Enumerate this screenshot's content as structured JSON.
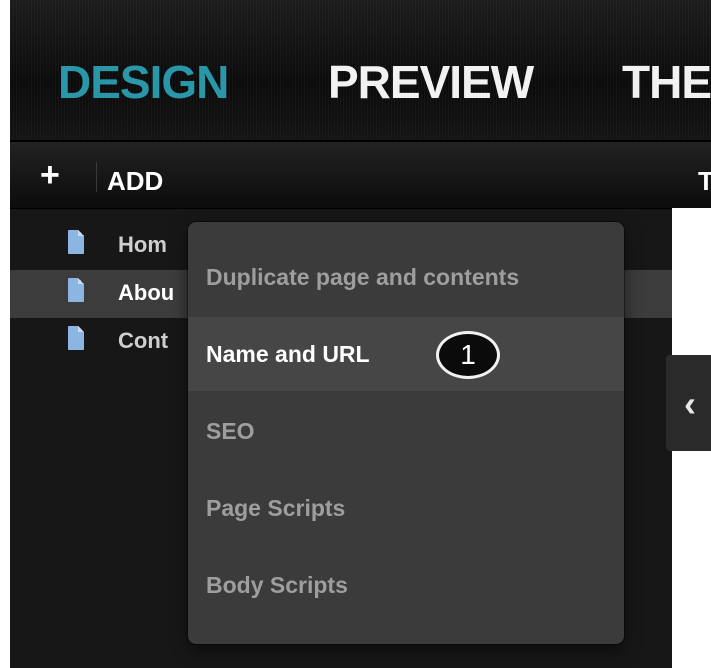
{
  "topnav": {
    "tabs": [
      {
        "label": "DESIGN"
      },
      {
        "label": "PREVIEW"
      },
      {
        "label": "THE"
      }
    ],
    "accent_color": "#2a97a8"
  },
  "left_panel": {
    "add_icon": "+",
    "add_label": "ADD",
    "pages": [
      {
        "label": "Hom",
        "icon": "page-icon"
      },
      {
        "label": "Abou",
        "icon": "page-icon"
      },
      {
        "label": "Cont",
        "icon": "page-icon"
      }
    ],
    "page_icon_color": "#8cb6e2"
  },
  "right_area": {
    "header_letter": "T",
    "collapse_arrow": "‹"
  },
  "context_menu": {
    "items": [
      {
        "label": "Duplicate page and contents"
      },
      {
        "label": "Name and URL"
      },
      {
        "label": "SEO"
      },
      {
        "label": "Page Scripts"
      },
      {
        "label": "Body Scripts"
      }
    ],
    "step_badge": "1"
  }
}
